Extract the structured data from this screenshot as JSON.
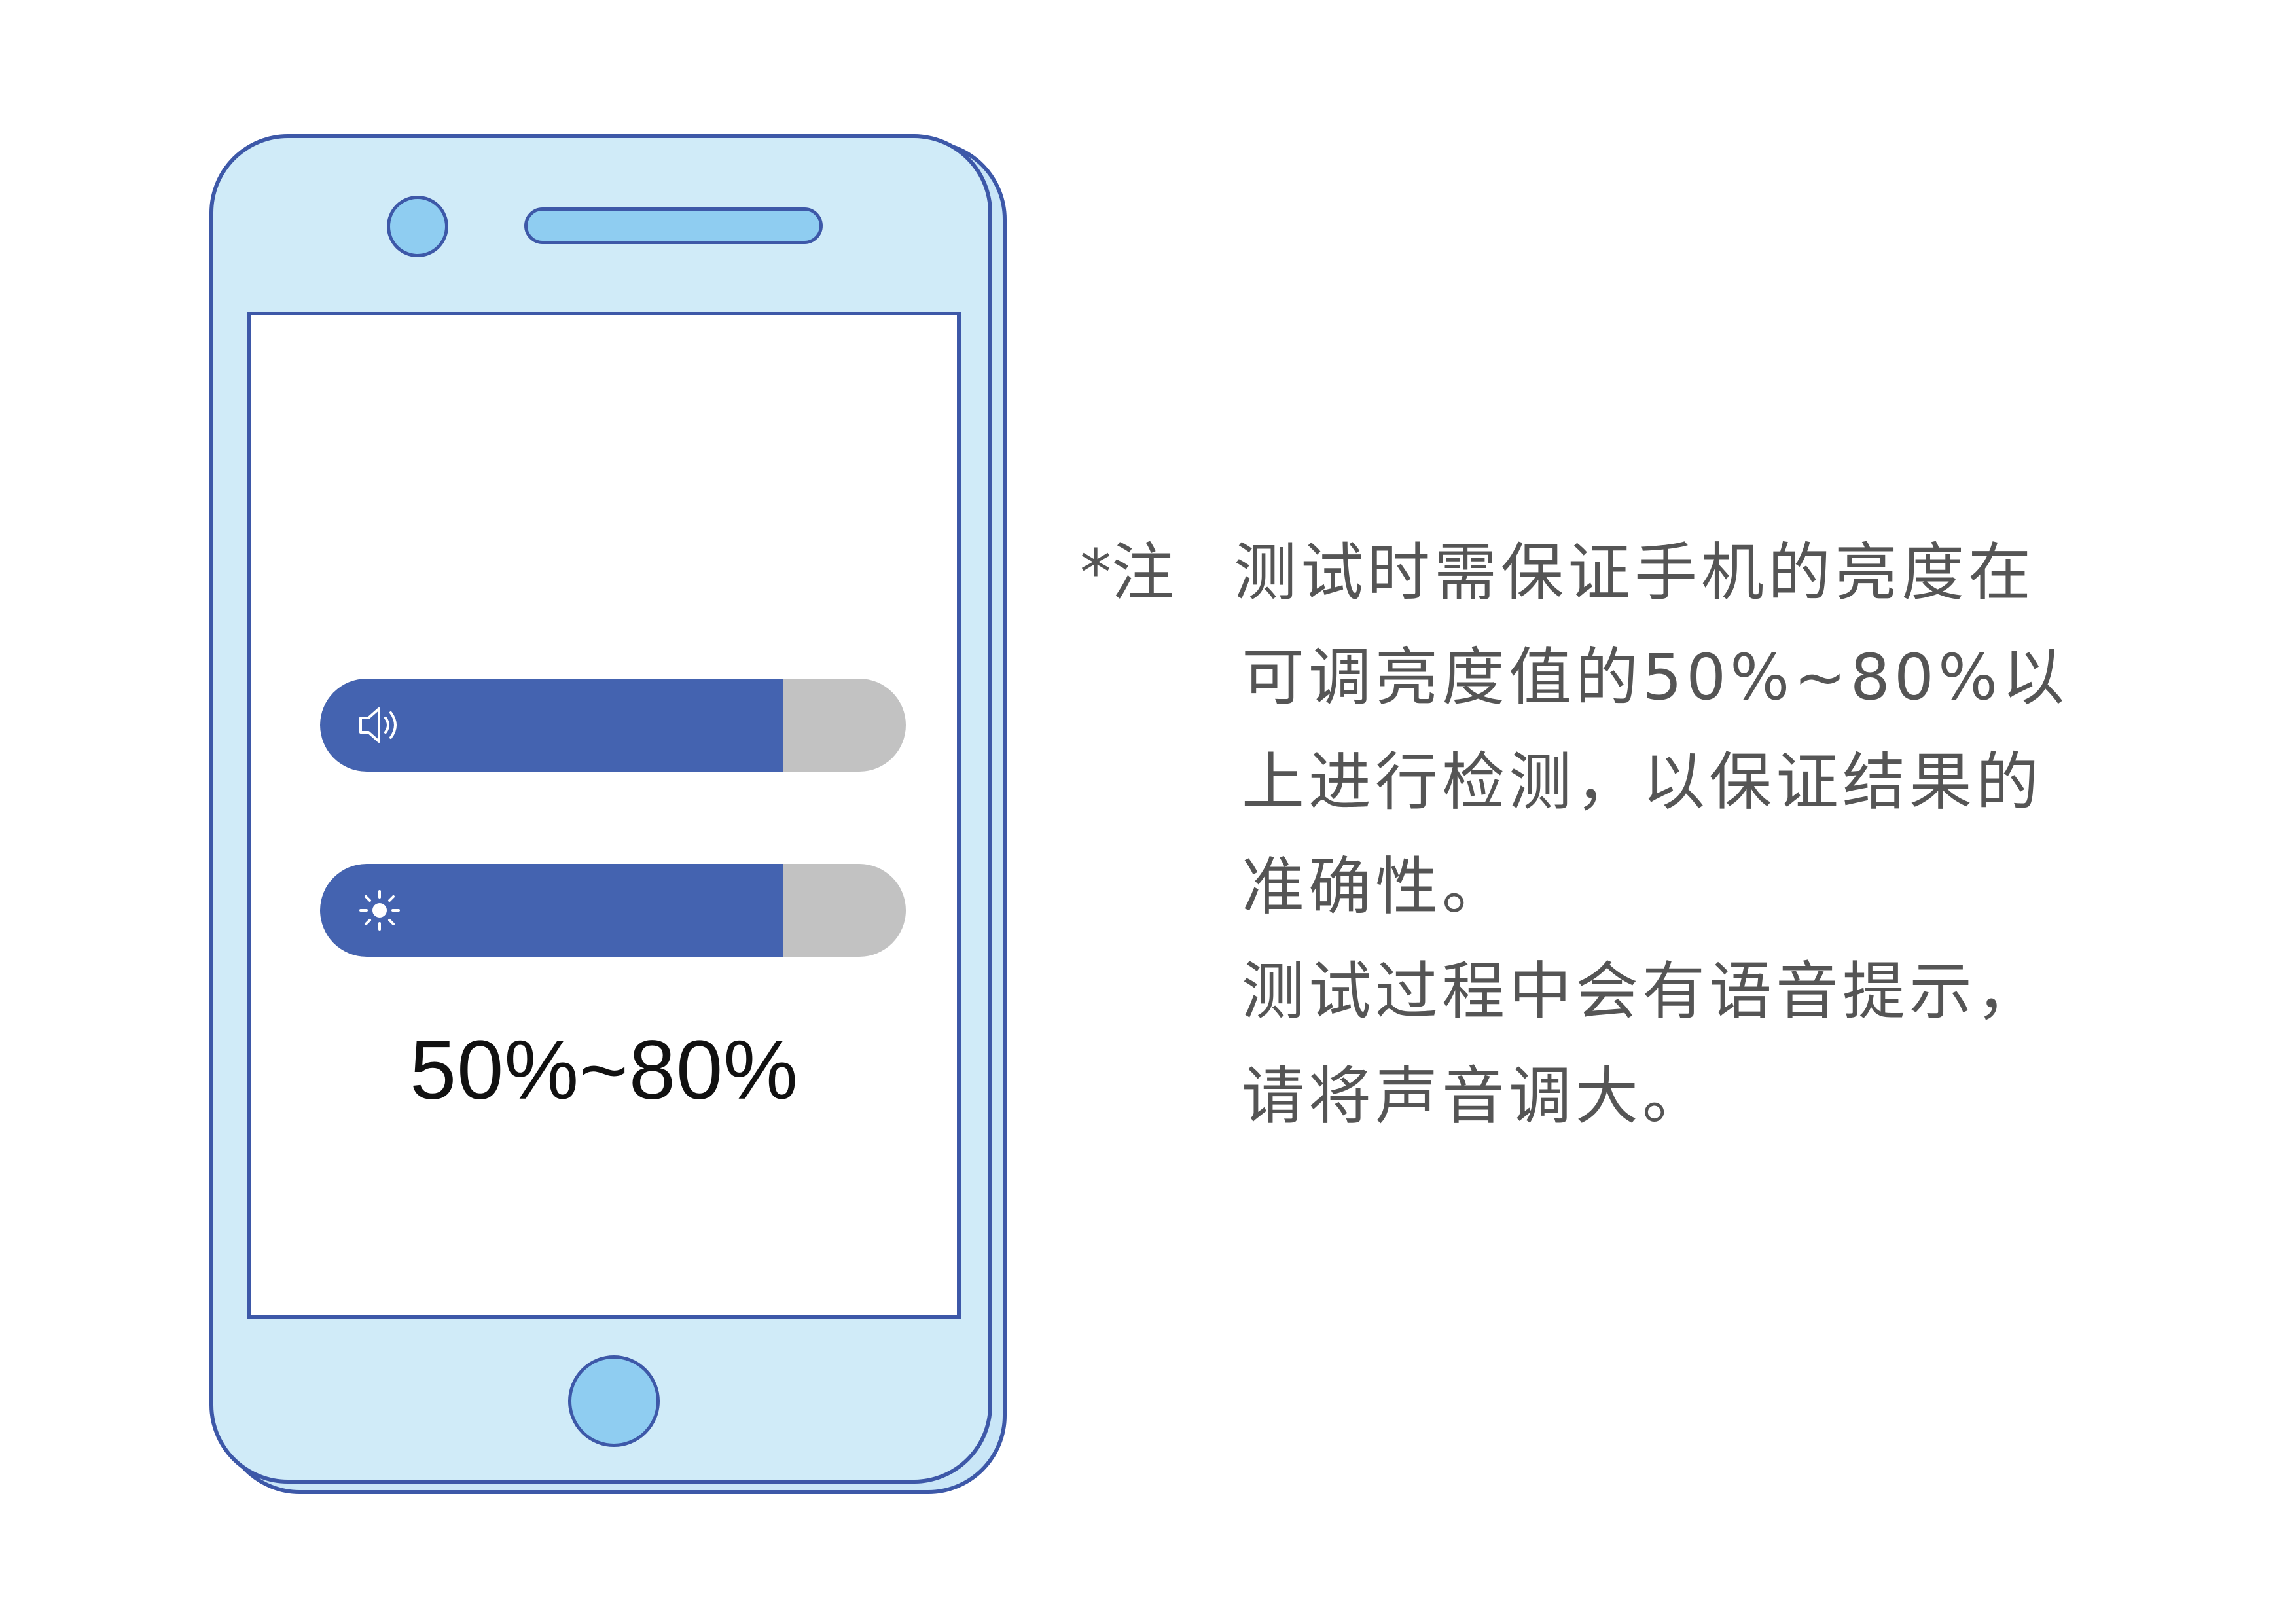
{
  "phone": {
    "volume_level_percent": 79,
    "brightness_level_percent": 79,
    "range_text": "50%~80%",
    "colors": {
      "outline": "#3d58a8",
      "body": "#d0ebf8",
      "accent": "#8fcdf1",
      "slider_fill": "#4463b0",
      "slider_track": "#c2c2c2"
    },
    "icons": {
      "volume": "speaker-icon",
      "brightness": "sun-icon"
    }
  },
  "note": {
    "label": "*注",
    "lines": [
      "测试时需保证手机的亮度在",
      "可调亮度值的50%~80%以",
      "上进行检测，以保证结果的",
      "准确性。",
      "测试过程中会有语音提示，",
      "请将声音调大。"
    ]
  }
}
